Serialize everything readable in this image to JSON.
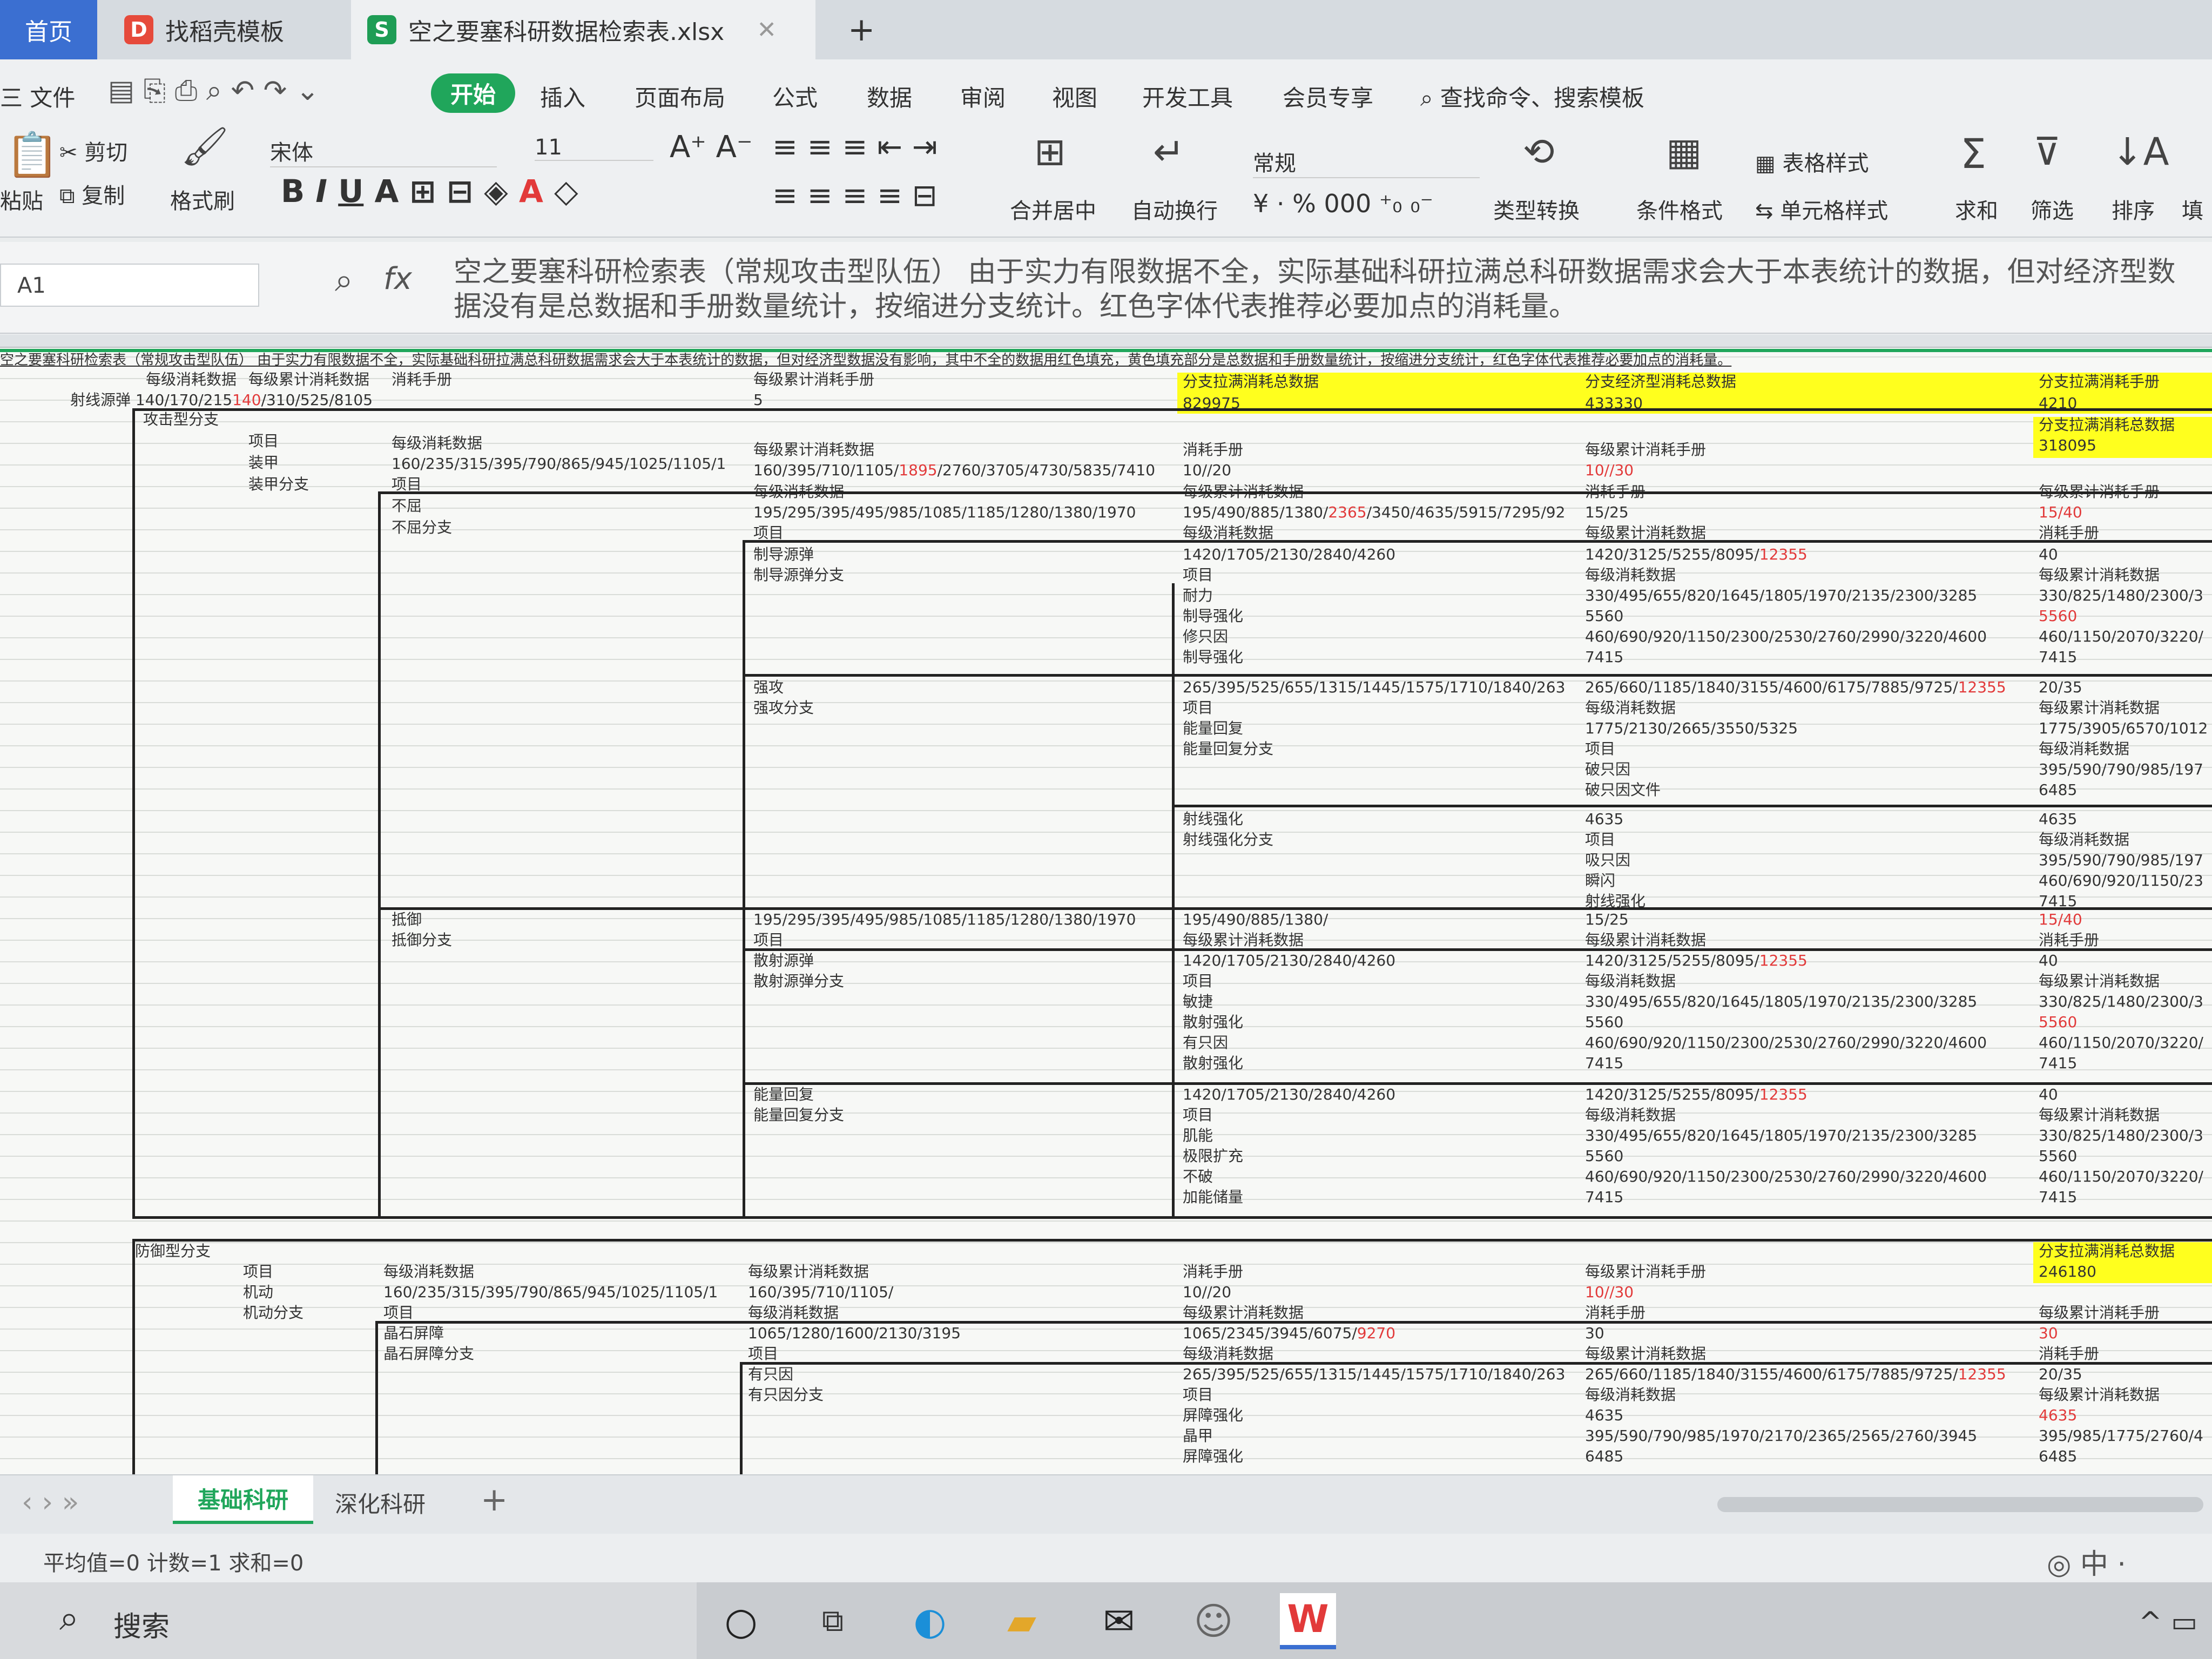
{
  "tabs": {
    "home": "首页",
    "template": "找稻壳模板",
    "file": "空之要塞科研数据检索表.xlsx",
    "new_tab": "+"
  },
  "menu": {
    "file": "三 文件",
    "start": "开始",
    "insert": "插入",
    "layout": "页面布局",
    "formula": "公式",
    "data": "数据",
    "review": "审阅",
    "view": "视图",
    "dev": "开发工具",
    "member": "会员专享",
    "search": "查找命令、搜索模板"
  },
  "ribbon": {
    "cut": "剪切",
    "paste": "粘贴",
    "copy": "复制",
    "format_painter": "格式刷",
    "font": "宋体",
    "size": "11",
    "merge": "合并居中",
    "wrap": "自动换行",
    "numfmt": "常规",
    "convert": "类型转换",
    "cond": "条件格式",
    "table_style": "表格样式",
    "cell_style": "单元格样式",
    "sum": "求和",
    "filter": "筛选",
    "sort": "排序",
    "fill": "填"
  },
  "formula_bar": {
    "cell_ref": "A1",
    "fx": "fx",
    "content": "空之要塞科研检索表（常规攻击型队伍） 由于实力有限数据不全，实际基础科研拉满总科研数据需求会大于本表统计的数据，但对经济型数据没有是总数据和手册数量统计，按缩进分支统计。红色字体代表推荐必要加点的消耗量。"
  },
  "sheet": {
    "banner": "空之要塞科研检索表（常规攻击型队伍） 由于实力有限数据不全，实际基础科研拉满总科研数据需求会大于本表统计的数据，但对经济型数据没有影响，其中不全的数据用红色填充，黄色填充部分是总数据和手册数量统计，按缩进分支统计，红色字体代表推荐必要加点的消耗量。",
    "labels": {
      "per_level": "每级消耗数据",
      "cum_data": "每级累计消耗数据",
      "manual": "消耗手册",
      "cum_manual": "每级累计消耗手册",
      "item": "项目",
      "attack_branch": "攻击型分支",
      "defense_branch": "防御型分支",
      "branch_total_yellow": "分支拉满消耗总数据",
      "econ_total_yellow": "分支经济型消耗总数据",
      "branch_manual_yellow": "分支拉满消耗手册"
    },
    "top": {
      "r1": "射线源弹 140/170/215",
      "r1_red": "140",
      "r1_tail": "/310/525/8105",
      "manual_5": "5",
      "total1": "829975",
      "total2": "433330",
      "total3": "4210",
      "total4": "318095"
    },
    "rows_a": {
      "armor": "装甲",
      "armor_branch": "装甲分支",
      "series1": "160/235/315/395/790/865/945/1025/1105/1",
      "series2": "160/395/710/1105/",
      "series2_red": "1895",
      "series2_tail": "/2760/3705/4730/5835/7410",
      "manual_10_20": "10//20",
      "manual_10_30": "10//30",
      "cum_manual_15_25": "15/25",
      "cum_manual_15_40": "15/40",
      "hp": "不屈",
      "hp_branch": "不屈分支",
      "series3": "195/295/395/495/985/1085/1185/1280/1380/1970",
      "series4": "195/490/885/1380/",
      "series4_red": "2365",
      "series4_tail": "/3450/4635/5915/7295/92",
      "res1": "制导源弹",
      "res1_branch": "制导源弹分支",
      "series5": "1420/1705/2130/2840/4260",
      "series6": "1420/3125/5255/8095/",
      "series6_red": "12355",
      "f1": "耐力",
      "f2": "制导强化",
      "f3": "修只因",
      "f4": "制导强化",
      "series7": "330/495/655/820/1645/1805/1970/2135/2300/3285",
      "series8": "330/825/1480/2300/3",
      "v5560": "5560",
      "series9": "460/690/920/1150/2300/2530/2760/2990/3220/4600",
      "series10": "460/1150/2070/3220/",
      "v7415": "7415",
      "v40": "40",
      "strong": "强攻",
      "strong_branch": "强攻分支",
      "series11": "265/395/525/655/1315/1445/1575/1710/1840/263",
      "series12": "265/660/1185/1840/3155/4600/6175/7885/9725/",
      "series12_red": "12355",
      "cum_20_35": "20/35",
      "energy": "能量回复",
      "energy_branch": "能量回复分支",
      "series13": "1775/2130/2665/3550/5325",
      "series14": "1775/3905/6570/1012",
      "g1": "破只因",
      "g2": "破只因文件",
      "series15": "395/590/790/985/197",
      "v6485": "6485",
      "v4635": "4635",
      "ray": "射线强化",
      "ray_branch": "射线强化分支",
      "h1": "吸只因",
      "h2": "瞬闪",
      "h3": "射线强化",
      "series16": "395/590/790/985/197",
      "series17": "460/690/920/1150/23"
    },
    "rows_b": {
      "defense": "抵御",
      "defense_branch": "抵御分支",
      "laser": "散射源弹",
      "laser_branch": "散射源弹分支",
      "j1": "敏捷",
      "j2": "散射强化",
      "j3": "有只因",
      "j4": "散射强化",
      "energy2": "能量回复",
      "energy2_branch": "能量回复分支",
      "k1": "肌能",
      "k2": "极限扩充",
      "k3": "不破",
      "k4": "加能储量"
    },
    "rows_c": {
      "mobility": "机动",
      "mobility_branch": "机动分支",
      "total5": "246180",
      "shield": "晶石屏障",
      "shield_branch": "晶石屏障分支",
      "series18": "1065/1280/1600/2130/3195",
      "series19": "1065/2345/3945/6075/",
      "series19_red": "9270",
      "v30": "30",
      "w1": "有只因",
      "w2": "有只因分支",
      "m1": "屏障强化",
      "m2": "晶甲",
      "m3": "屏障强化",
      "series20": "265/395/525/655/1315/1445/1575/1710/1840/263",
      "series21": "265/660/1185/1840/3155/4600/6175/7885/9725/",
      "series22": "395/590/790/985/1970/2170/2365/2565/2760/3945",
      "series23": "395/985/1775/2760/4",
      "red4635": "4635"
    }
  },
  "sheet_tabs": {
    "t1": "基础科研",
    "t2": "深化科研",
    "add": "+"
  },
  "status": {
    "text": "平均值=0 计数=1 求和=0"
  },
  "taskbar": {
    "search": "搜索"
  },
  "colors": {
    "accent": "#20a65b",
    "highlight": "#ffff1e",
    "red": "#e23a3a",
    "home_tab": "#3b6fd1"
  }
}
